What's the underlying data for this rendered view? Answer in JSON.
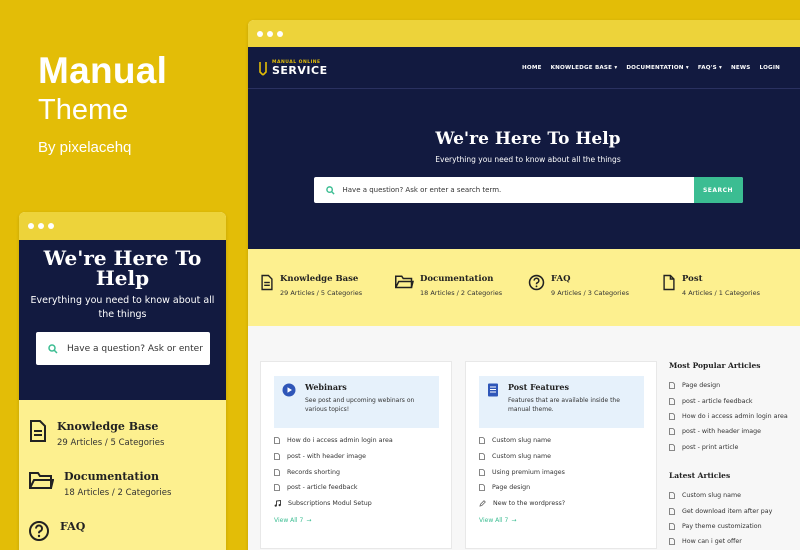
{
  "brand": {
    "title": "Manual",
    "subtitle": "Theme",
    "by": "By pixelacehq"
  },
  "hero": {
    "title": "We're Here To Help",
    "subtitle": "Everything you need to know about all the things",
    "search_placeholder": "Have a question? Ask or enter a search term.",
    "mobile_search_placeholder": "Have a question? Ask or enter",
    "search_button": "SEARCH"
  },
  "logo": {
    "small": "MANUAL ONLINE",
    "big": "SERVICE"
  },
  "nav": [
    "HOME",
    "KNOWLEDGE BASE ▾",
    "DOCUMENTATION ▾",
    "FAQ'S ▾",
    "NEWS",
    "LOGIN"
  ],
  "categories": [
    {
      "title": "Knowledge Base",
      "stats": "29 Articles / 5 Categories",
      "icon": "document-icon"
    },
    {
      "title": "Documentation",
      "stats": "18 Articles / 2 Categories",
      "icon": "folder-icon"
    },
    {
      "title": "FAQ",
      "stats": "9 Articles / 3 Categories",
      "icon": "question-icon"
    },
    {
      "title": "Post",
      "stats": "4 Articles / 1 Categories",
      "icon": "file-icon"
    }
  ],
  "cards": [
    {
      "title": "Webinars",
      "desc": "See post and upcoming webinars on various topics!",
      "items": [
        "How do i access admin login area",
        "post - with header image",
        "Records shorting",
        "post - article feedback",
        "Subscriptions Modul Setup"
      ],
      "view_all": "View All 7"
    },
    {
      "title": "Post Features",
      "desc": "Features that are available inside the manual theme.",
      "items": [
        "Custom slug name",
        "Custom slug name",
        "Using premium images",
        "Page design",
        "New to the wordpress?"
      ],
      "view_all": "View All 7"
    }
  ],
  "sidebar": {
    "popular_title": "Most Popular Articles",
    "popular": [
      "Page design",
      "post - article feedback",
      "How do i access admin login area",
      "post - with header image",
      "post - print article"
    ],
    "latest_title": "Latest Articles",
    "latest": [
      "Custom slug name",
      "Get download item after pay",
      "Pay theme customization",
      "How can i get offer"
    ]
  },
  "colors": {
    "navy": "#121a40",
    "yellow": "#e3bd07",
    "light_yellow": "#fdf08f",
    "accent": "#3bbd92"
  }
}
